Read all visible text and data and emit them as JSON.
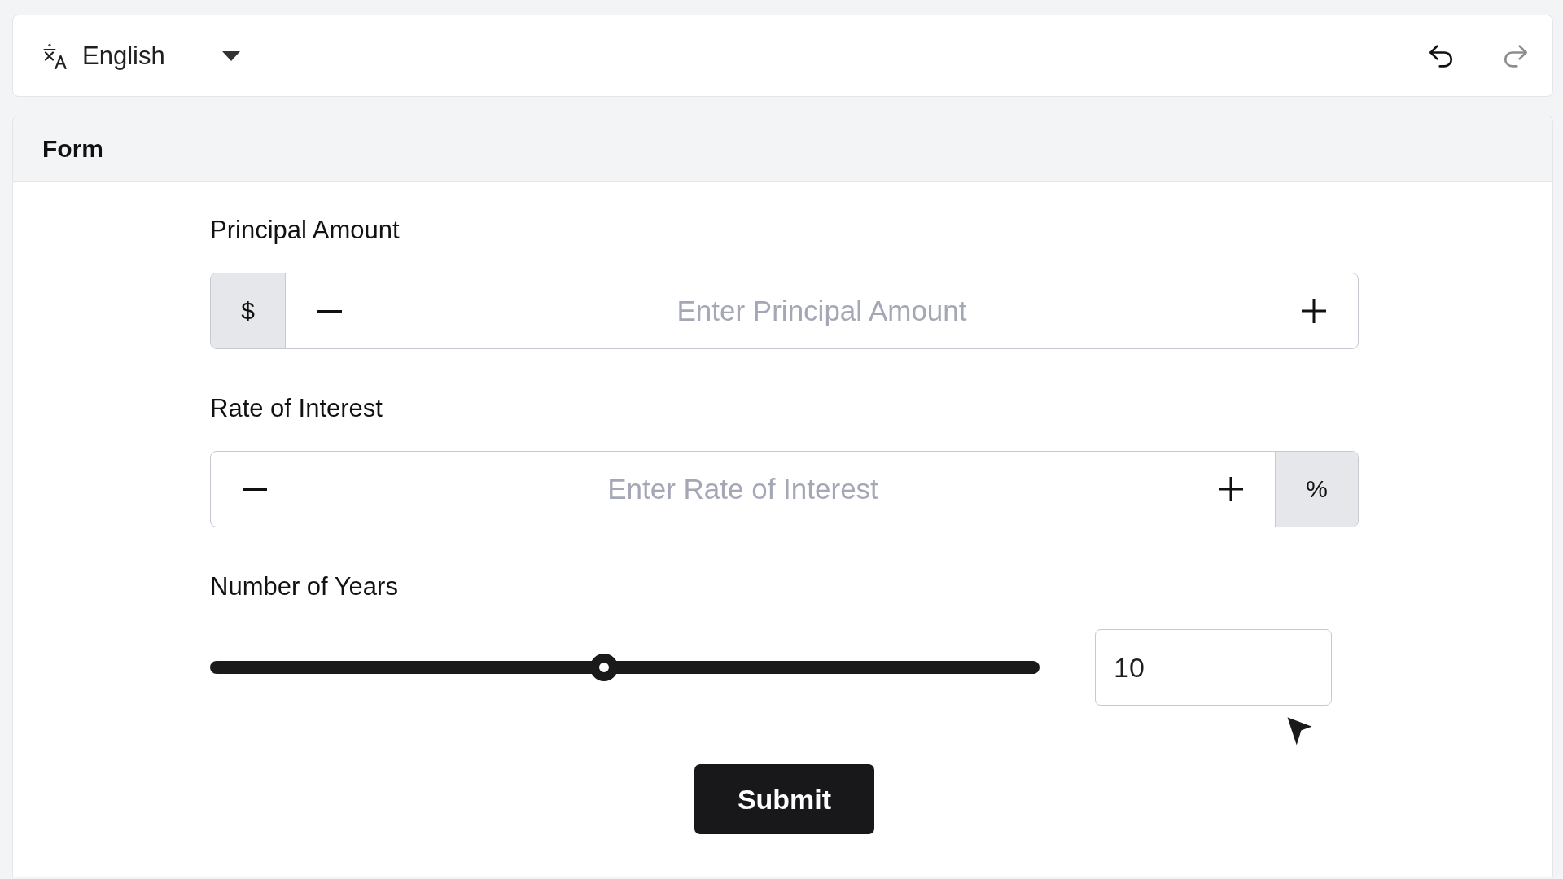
{
  "toolbar": {
    "language": {
      "label": "English"
    },
    "undo": {
      "disabled": false
    },
    "redo": {
      "disabled": true
    }
  },
  "form": {
    "title": "Form",
    "fields": [
      {
        "kind": "stepper",
        "label": "Principal Amount",
        "placeholder": "Enter Principal Amount",
        "prefix": "$"
      },
      {
        "kind": "stepper",
        "label": "Rate of Interest",
        "placeholder": "Enter Rate of Interest",
        "suffix": "%"
      },
      {
        "kind": "slider",
        "label": "Number of Years",
        "level": 0.475,
        "value": "10"
      }
    ],
    "submit": {
      "label": "Submit"
    }
  }
}
